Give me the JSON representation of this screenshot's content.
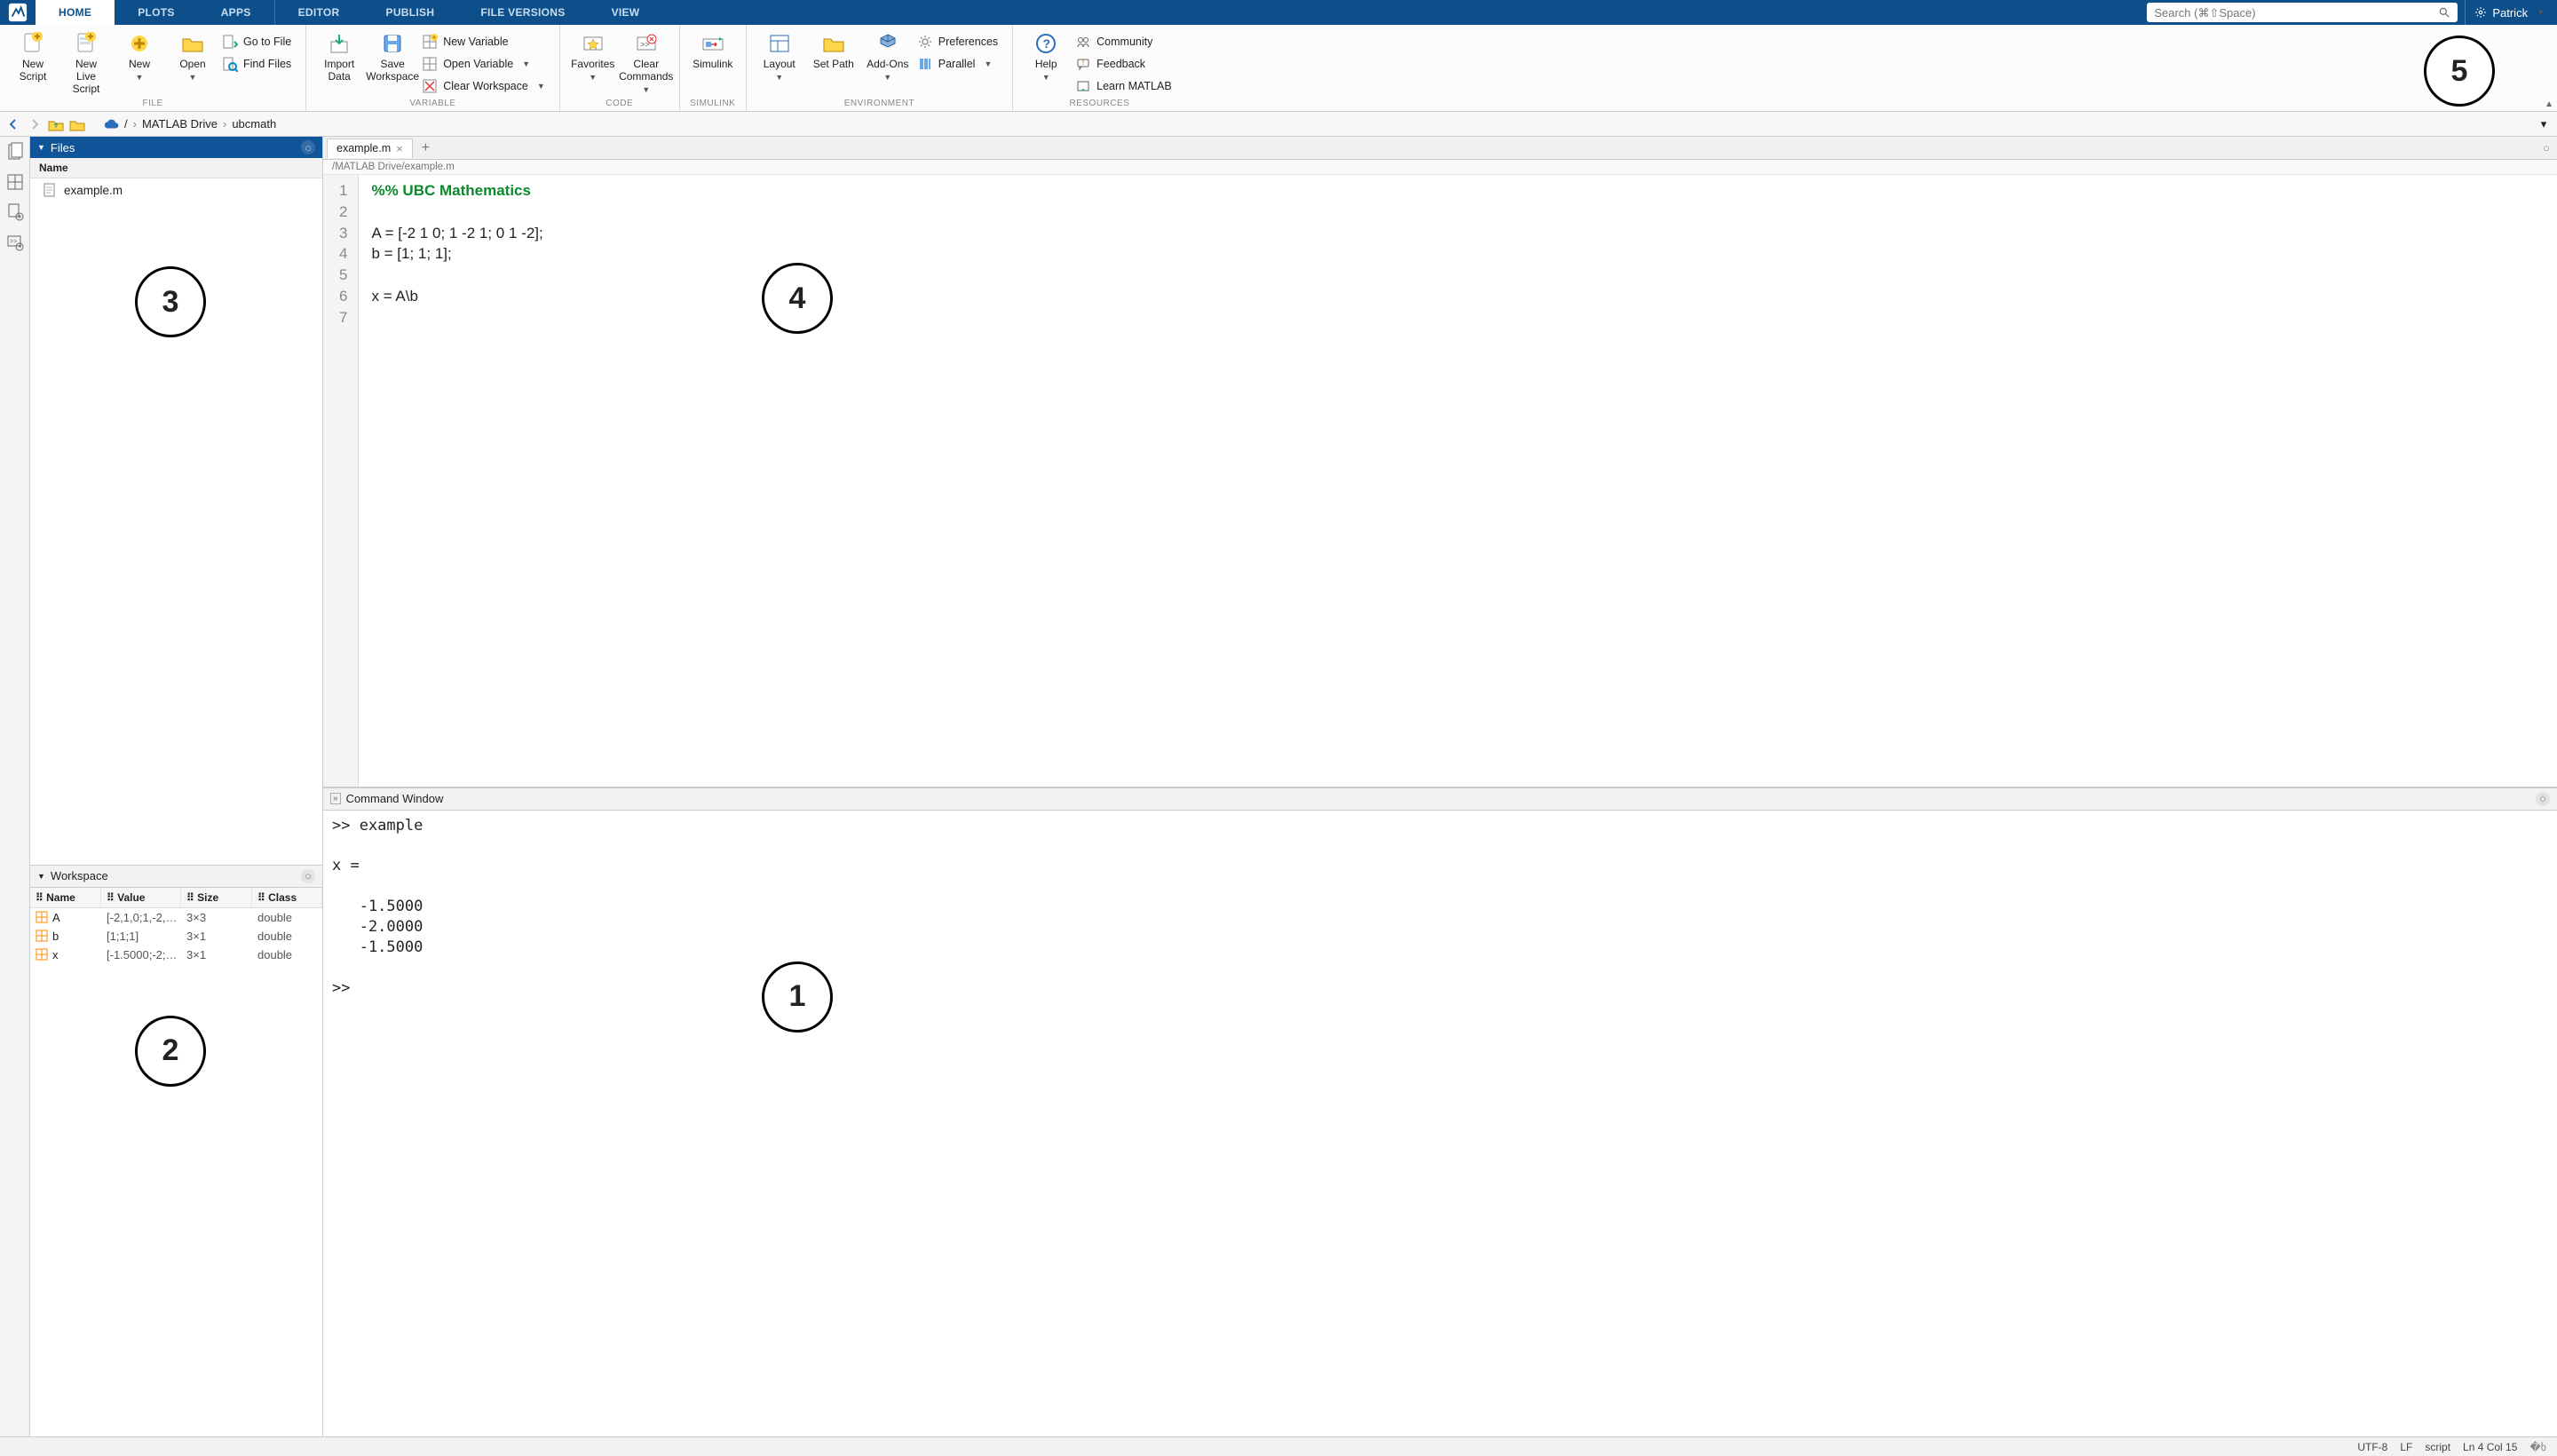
{
  "tabs": [
    "HOME",
    "PLOTS",
    "APPS",
    "EDITOR",
    "PUBLISH",
    "FILE VERSIONS",
    "VIEW"
  ],
  "active_tab": 0,
  "search": {
    "placeholder": "Search (⌘⇧Space)"
  },
  "user": {
    "name": "Patrick"
  },
  "ribbon": {
    "file": {
      "label": "FILE",
      "new_script": "New\nScript",
      "new_live": "New\nLive Script",
      "new": "New",
      "open": "Open",
      "goto": "Go to File",
      "find": "Find Files"
    },
    "variable": {
      "label": "VARIABLE",
      "import": "Import\nData",
      "save_ws": "Save\nWorkspace",
      "new_var": "New Variable",
      "open_var": "Open Variable",
      "clear_ws": "Clear Workspace"
    },
    "code": {
      "label": "CODE",
      "favorites": "Favorites",
      "clear_cmds": "Clear\nCommands"
    },
    "simulink": {
      "label": "SIMULINK",
      "simulink": "Simulink"
    },
    "environment": {
      "label": "ENVIRONMENT",
      "layout": "Layout",
      "setpath": "Set Path",
      "addons": "Add-Ons",
      "prefs": "Preferences",
      "parallel": "Parallel"
    },
    "resources": {
      "label": "RESOURCES",
      "help": "Help",
      "community": "Community",
      "feedback": "Feedback",
      "learn": "Learn MATLAB"
    }
  },
  "path": {
    "root": "/",
    "segments": [
      "MATLAB Drive",
      "ubcmath"
    ]
  },
  "files_panel": {
    "title": "Files",
    "col": "Name",
    "items": [
      {
        "name": "example.m"
      }
    ]
  },
  "workspace_panel": {
    "title": "Workspace",
    "cols": [
      "Name",
      "Value",
      "Size",
      "Class"
    ],
    "rows": [
      {
        "name": "A",
        "value": "[-2,1,0;1,-2,…",
        "size": "3×3",
        "class": "double"
      },
      {
        "name": "b",
        "value": "[1;1;1]",
        "size": "3×1",
        "class": "double"
      },
      {
        "name": "x",
        "value": "[-1.5000;-2;…",
        "size": "3×1",
        "class": "double"
      }
    ]
  },
  "editor": {
    "tab": "example.m",
    "path": "/MATLAB Drive/example.m",
    "lines": [
      {
        "n": 1,
        "text": "%% UBC Mathematics",
        "section": true
      },
      {
        "n": 2,
        "text": ""
      },
      {
        "n": 3,
        "text": "A = [-2 1 0; 1 -2 1; 0 1 -2];"
      },
      {
        "n": 4,
        "text": "b = [1; 1; 1];"
      },
      {
        "n": 5,
        "text": ""
      },
      {
        "n": 6,
        "text": "x = A\\b"
      },
      {
        "n": 7,
        "text": ""
      }
    ]
  },
  "command_window": {
    "title": "Command Window",
    "content": ">> example\n\nx =\n\n   -1.5000\n   -2.0000\n   -1.5000\n\n>> "
  },
  "status": {
    "encoding": "UTF-8",
    "eol": "LF",
    "type": "script",
    "pos": "Ln 4 Col 15"
  },
  "annotations": [
    "1",
    "2",
    "3",
    "4",
    "5"
  ]
}
